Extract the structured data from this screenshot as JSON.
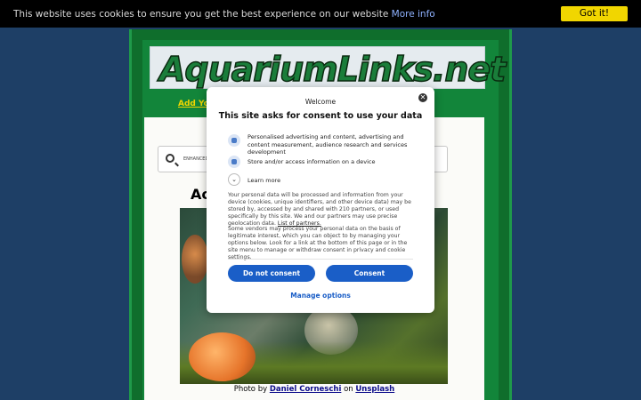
{
  "cookie_bar": {
    "message": "This website uses cookies to ensure you get the best experience on our website",
    "more_info": "More info",
    "got_it": "Got it!"
  },
  "site": {
    "logo": "AquariumLinks.net",
    "nav_link": "Add You",
    "search_label": "ENHANCED",
    "heading_fragment": "Ac",
    "photo_caption": {
      "prefix": "Photo by",
      "author": "Daniel Corneschi",
      "on": "on",
      "source": "Unsplash"
    }
  },
  "consent": {
    "welcome": "Welcome",
    "title": "This site asks for consent to use your data",
    "purposes": [
      "Personalised advertising and content, advertising and content measurement, audience research and services development",
      "Store and/or access information on a device"
    ],
    "learn_more": "Learn more",
    "paragraph1": "Your personal data will be processed and information from your device (cookies, unique identifiers, and other device data) may be stored by, accessed by and shared with 210 partners, or used specifically by this site. We and our partners may use precise geolocation data.",
    "partners_link": "List of partners.",
    "paragraph2": "Some vendors may process your personal data on the basis of legitimate interest, which you can object to by managing your options below. Look for a link at the bottom of this page or in the site menu to manage or withdraw consent in privacy and cookie settings.",
    "do_not_consent": "Do not consent",
    "consent": "Consent",
    "manage_options": "Manage options"
  }
}
